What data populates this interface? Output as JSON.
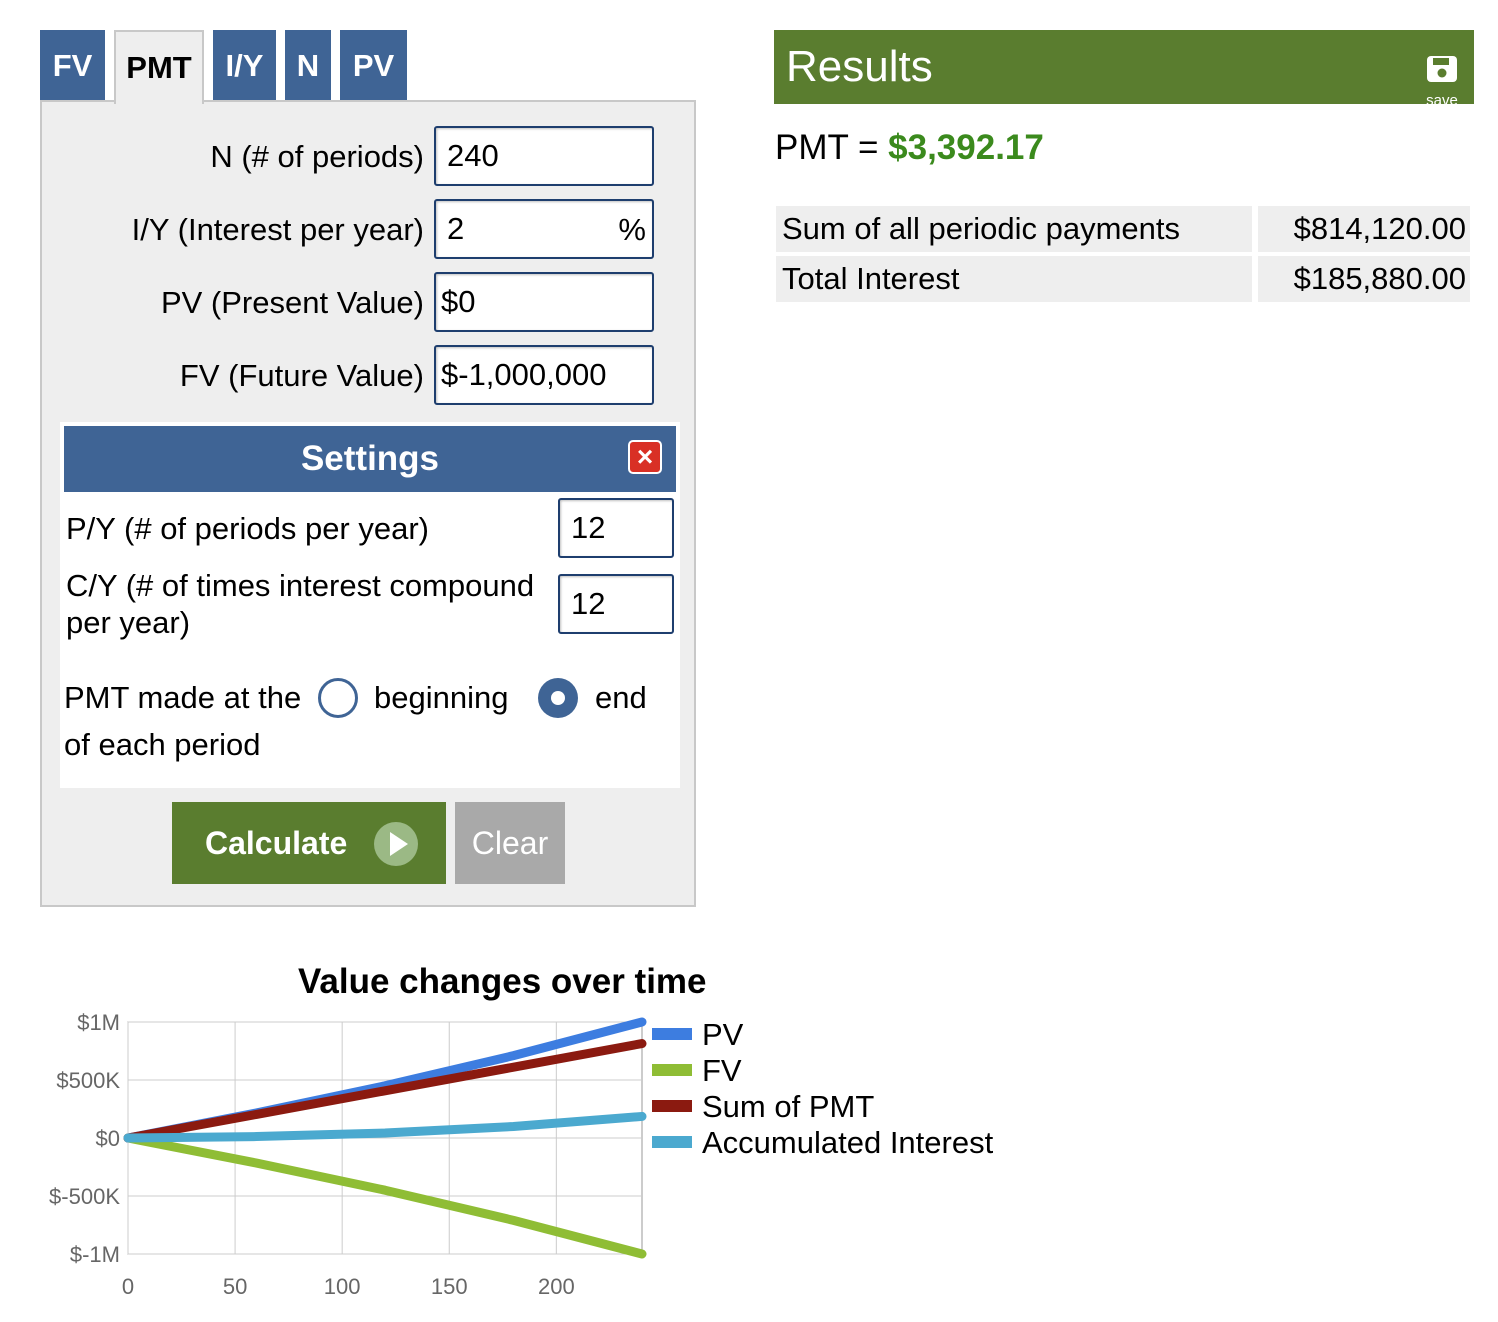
{
  "tabs": [
    {
      "label": "FV",
      "active": false
    },
    {
      "label": "PMT",
      "active": true
    },
    {
      "label": "I/Y",
      "active": false
    },
    {
      "label": "N",
      "active": false
    },
    {
      "label": "PV",
      "active": false
    }
  ],
  "fields": {
    "n_label": "N (# of periods)",
    "n_value": "240",
    "iy_label": "I/Y (Interest per year)",
    "iy_value": "2",
    "iy_unit": "%",
    "pv_label": "PV (Present Value)",
    "pv_value": "$0",
    "fv_label": "FV (Future Value)",
    "fv_value": "$-1,000,000"
  },
  "settings": {
    "title": "Settings",
    "close_icon": "×",
    "py_label": "P/Y (# of periods per year)",
    "py_value": "12",
    "cy_label_1": "C/Y (# of times interest compound",
    "cy_label_2": "per year)",
    "cy_value": "12",
    "pmt_made_label": "PMT made at the",
    "opt_beginning": "beginning",
    "opt_end": "end",
    "of_each_period": "of each period",
    "selected": "end"
  },
  "buttons": {
    "calculate": "Calculate",
    "clear": "Clear"
  },
  "results": {
    "title": "Results",
    "save_label": "save",
    "pmt_label": "PMT = ",
    "pmt_value": "$3,392.17",
    "rows": [
      {
        "label": "Sum of all periodic payments",
        "value": "$814,120.00"
      },
      {
        "label": "Total Interest",
        "value": "$185,880.00"
      }
    ]
  },
  "colors": {
    "tab_blue": "#3f6495",
    "results_green": "#5a7d2f",
    "pmt_green": "#3b8a1d"
  },
  "chart_data": {
    "type": "line",
    "title": "Value changes over time",
    "xlim": [
      0,
      240
    ],
    "ylim": [
      -1000000,
      1000000
    ],
    "x_ticks": [
      "0",
      "50",
      "100",
      "150",
      "200"
    ],
    "x_tick_values": [
      0,
      50,
      100,
      150,
      200
    ],
    "y_ticks": [
      "$1M",
      "$500K",
      "$0",
      "$-500K",
      "$-1M"
    ],
    "y_tick_values": [
      1000000,
      500000,
      0,
      -500000,
      -1000000
    ],
    "legend_position": "right",
    "series": [
      {
        "name": "PV",
        "color": "#3d7de0",
        "x": [
          0,
          60,
          120,
          180,
          240
        ],
        "y": [
          0,
          216000,
          450000,
          710000,
          1000000
        ]
      },
      {
        "name": "FV",
        "color": "#8fbd35",
        "x": [
          0,
          60,
          120,
          180,
          240
        ],
        "y": [
          0,
          -216000,
          -450000,
          -710000,
          -1000000
        ]
      },
      {
        "name": "Sum of PMT",
        "color": "#8b1a10",
        "x": [
          0,
          60,
          120,
          180,
          240
        ],
        "y": [
          0,
          203530,
          407060,
          610590,
          814120
        ]
      },
      {
        "name": "Accumulated Interest",
        "color": "#4ba9cf",
        "x": [
          0,
          60,
          120,
          180,
          240
        ],
        "y": [
          0,
          12470,
          42940,
          99410,
          185880
        ]
      }
    ]
  }
}
